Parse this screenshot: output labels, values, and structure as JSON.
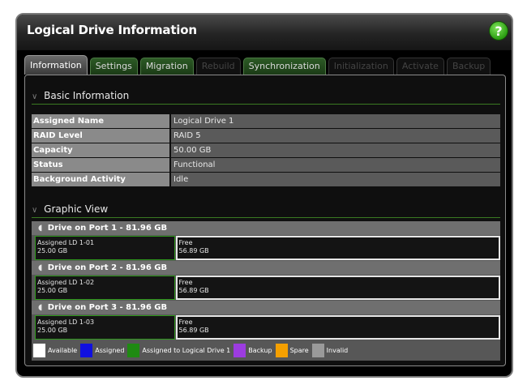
{
  "window": {
    "title": "Logical Drive Information",
    "help_label": "?"
  },
  "tabs": [
    {
      "label": "Information",
      "state": "active"
    },
    {
      "label": "Settings",
      "state": "enabled"
    },
    {
      "label": "Migration",
      "state": "enabled"
    },
    {
      "label": "Rebuild",
      "state": "disabled"
    },
    {
      "label": "Synchronization",
      "state": "enabled"
    },
    {
      "label": "Initialization",
      "state": "disabled"
    },
    {
      "label": "Activate",
      "state": "disabled"
    },
    {
      "label": "Backup",
      "state": "disabled"
    }
  ],
  "basic_info": {
    "header": "Basic Information",
    "rows": [
      {
        "key": "Assigned Name",
        "value": "Logical Drive 1"
      },
      {
        "key": "RAID Level",
        "value": "RAID 5"
      },
      {
        "key": "Capacity",
        "value": "50.00 GB"
      },
      {
        "key": "Status",
        "value": "Functional"
      },
      {
        "key": "Background Activity",
        "value": "Idle"
      }
    ]
  },
  "graphic_view": {
    "header": "Graphic View",
    "ports": [
      {
        "title": "Drive on Port 1 - 81.96 GB",
        "assigned_name": "Assigned LD 1-01",
        "assigned_size": "25.00 GB",
        "free_label": "Free",
        "free_size": "56.89 GB"
      },
      {
        "title": "Drive on Port 2 - 81.96 GB",
        "assigned_name": "Assigned LD 1-02",
        "assigned_size": "25.00 GB",
        "free_label": "Free",
        "free_size": "56.89 GB"
      },
      {
        "title": "Drive on Port 3 - 81.96 GB",
        "assigned_name": "Assigned LD 1-03",
        "assigned_size": "25.00 GB",
        "free_label": "Free",
        "free_size": "56.89 GB"
      }
    ],
    "legend": [
      {
        "label": "Available",
        "color": "#ffffff"
      },
      {
        "label": "Assigned",
        "color": "#1010e0"
      },
      {
        "label": "Assigned to Logical Drive 1",
        "color": "#1f8a12"
      },
      {
        "label": "Backup",
        "color": "#9c3ce0"
      },
      {
        "label": "Spare",
        "color": "#f5a000"
      },
      {
        "label": "Invalid",
        "color": "#9a9a9a"
      }
    ]
  },
  "colors": {
    "accent_green": "#2f9a1c",
    "panel_bg": "#0f0f0f"
  }
}
